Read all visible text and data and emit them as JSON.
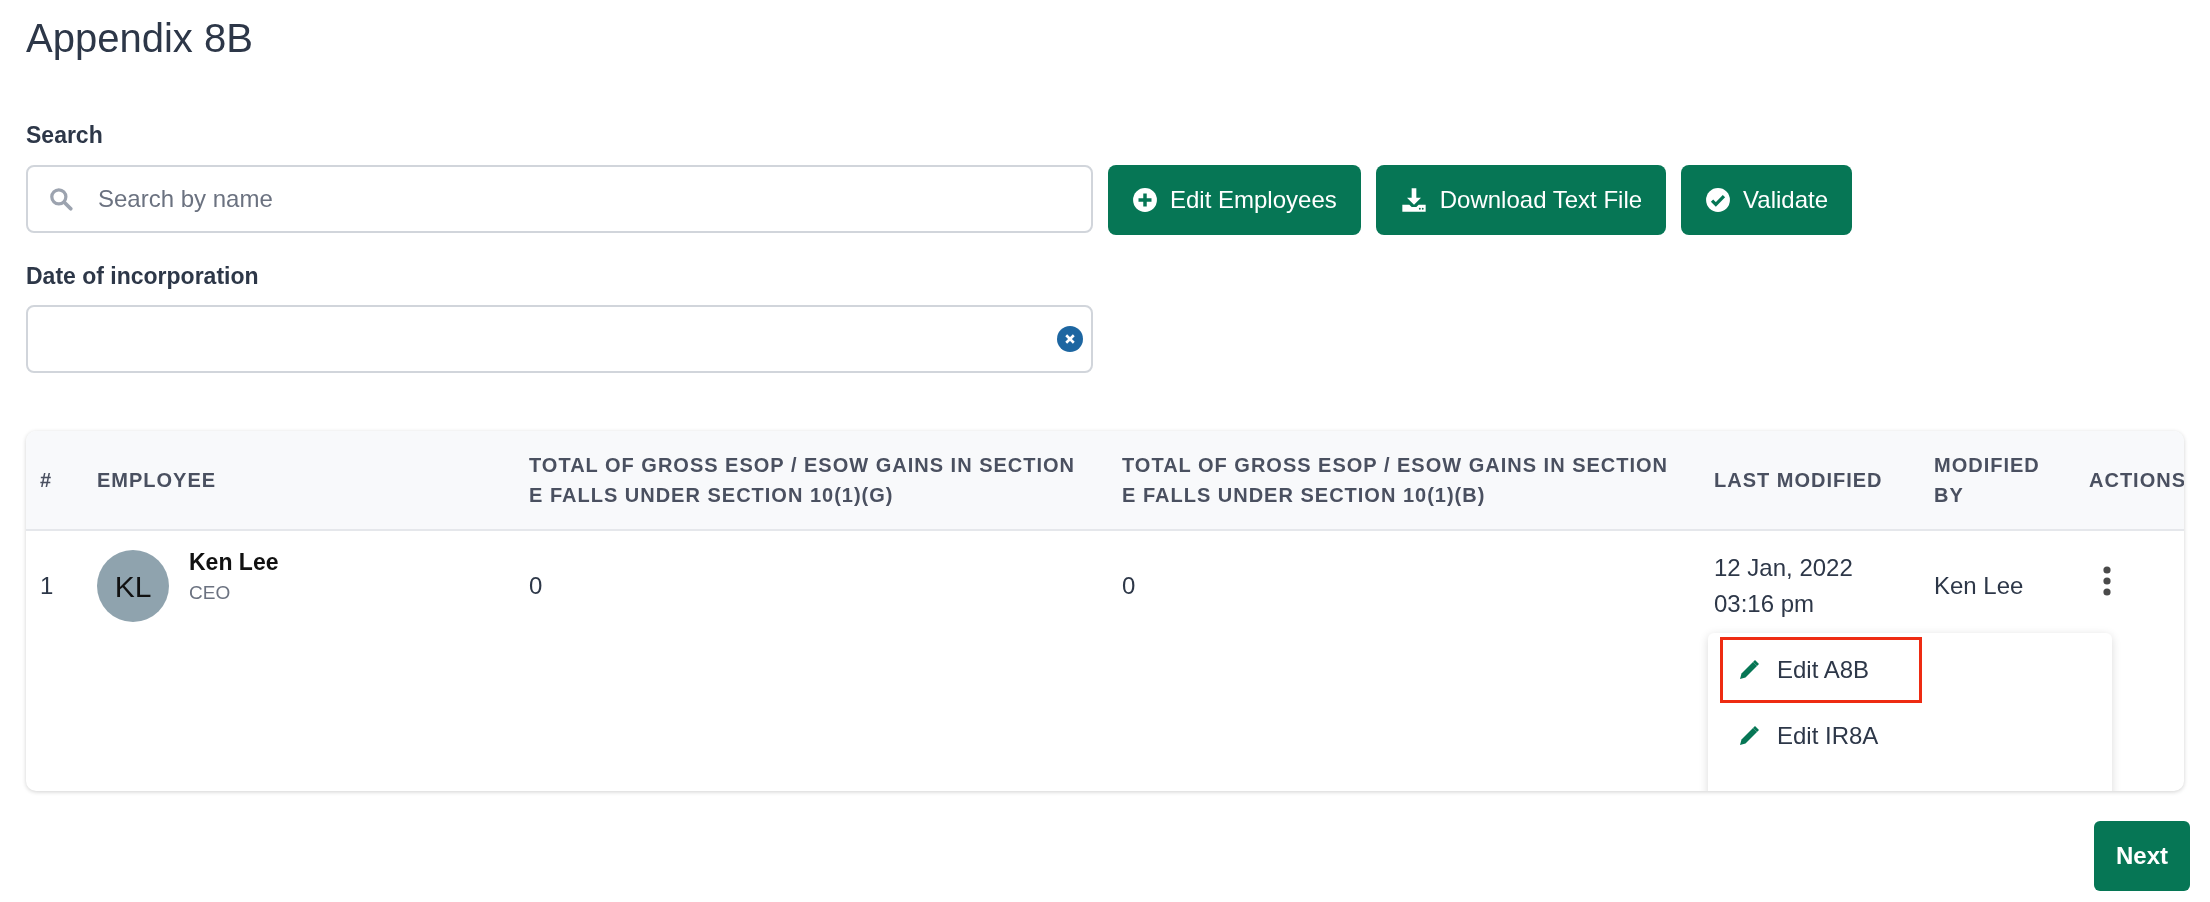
{
  "page": {
    "title": "Appendix 8B"
  },
  "search": {
    "label": "Search",
    "placeholder": "Search by name"
  },
  "buttons": [
    {
      "label": "Edit Employees",
      "kind": "plus"
    },
    {
      "label": "Download Text File",
      "kind": "download"
    },
    {
      "label": "Validate",
      "kind": "check"
    }
  ],
  "date_field": {
    "label": "Date of incorporation"
  },
  "table": {
    "columns": [
      "#",
      "EMPLOYEE",
      "TOTAL OF GROSS ESOP / ESOW GAINS IN SECTION E FALLS UNDER SECTION 10(1)(G)",
      "TOTAL OF GROSS ESOP / ESOW GAINS IN SECTION E FALLS UNDER SECTION 10(1)(B)",
      "LAST MODIFIED",
      "MODIFIED BY",
      "ACTIONS"
    ],
    "rows": [
      {
        "index": "1",
        "initials": "KL",
        "name": "Ken Lee",
        "role": "CEO",
        "gains_g": "0",
        "gains_b": "0",
        "last_modified": [
          "12 Jan, 2022",
          "03:16 pm"
        ],
        "modified_by": "Ken Lee"
      }
    ]
  },
  "action_menu": {
    "items": [
      {
        "label": "Edit A8B",
        "highlighted": true
      },
      {
        "label": "Edit IR8A",
        "highlighted": false
      }
    ]
  },
  "footer": {
    "next": "Next"
  }
}
